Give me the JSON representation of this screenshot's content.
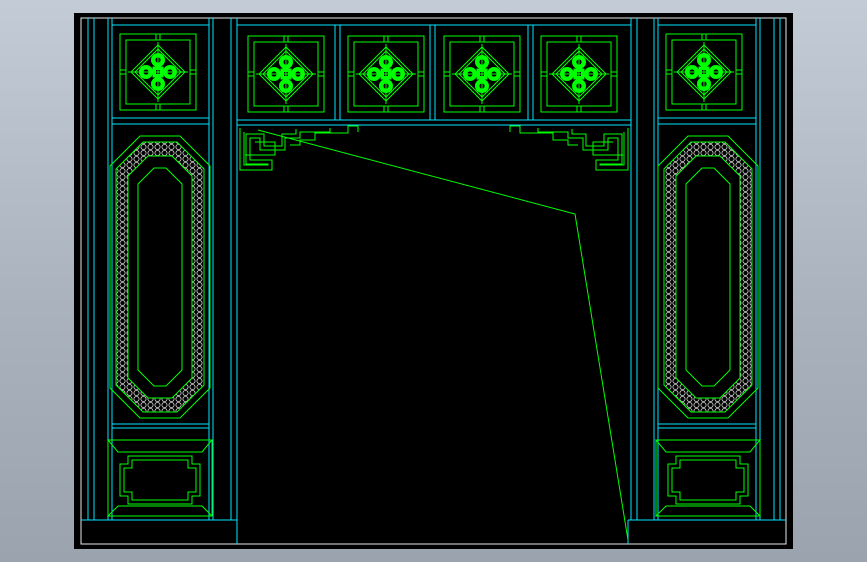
{
  "viewport": {
    "background_color": "#a9b2bd"
  },
  "drawing": {
    "paper_color": "#000000",
    "frame_color": "#1e1e1e",
    "cyan_line_color": "#00e5ff",
    "green_line_color": "#00ff00",
    "white_line_color": "#e8e8e8",
    "components": [
      "cad-drawing-frame",
      "top-lattice-frieze",
      "lattice-panel",
      "clover-knot-motif",
      "left-side-pillar",
      "right-side-pillar",
      "octagonal-hexagon-mesh-panel",
      "lower-rectangular-panel",
      "fretwork-bracket-left",
      "fretwork-bracket-right",
      "diagonal-guide-line"
    ]
  }
}
